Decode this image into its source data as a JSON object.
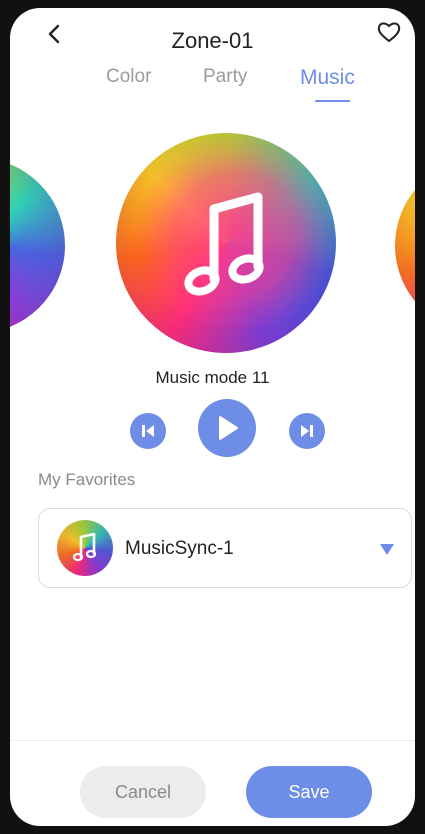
{
  "header": {
    "title": "Zone-01"
  },
  "tabs": [
    {
      "label": "Color",
      "active": false
    },
    {
      "label": "Party",
      "active": false
    },
    {
      "label": "Music",
      "active": true
    }
  ],
  "player": {
    "mode_label": "Music mode 11"
  },
  "favorites": {
    "heading": "My Favorites",
    "selected": "MusicSync-1"
  },
  "footer": {
    "cancel_label": "Cancel",
    "save_label": "Save"
  },
  "colors": {
    "accent": "#6d8de6",
    "cancel_bg": "#ececec"
  }
}
